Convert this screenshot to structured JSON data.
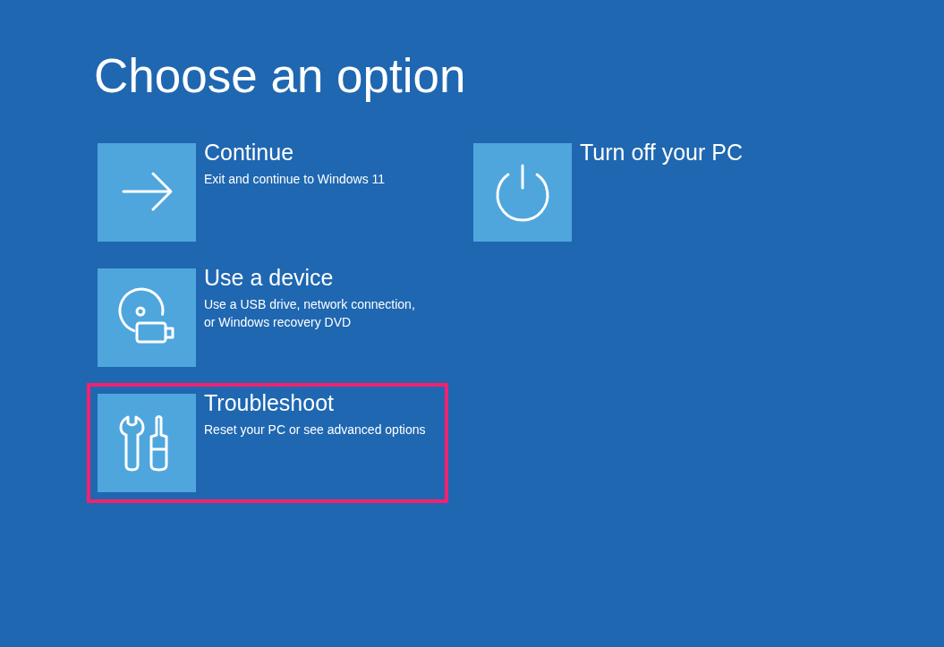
{
  "title": "Choose an option",
  "options": [
    {
      "label": "Continue",
      "description": "Exit and continue to Windows 11",
      "highlighted": false
    },
    {
      "label": "Use a device",
      "description": "Use a USB drive, network connection, or Windows recovery DVD",
      "highlighted": false
    },
    {
      "label": "Troubleshoot",
      "description": "Reset your PC or see advanced options",
      "highlighted": true
    },
    {
      "label": "Turn off your PC",
      "highlighted": false
    }
  ]
}
